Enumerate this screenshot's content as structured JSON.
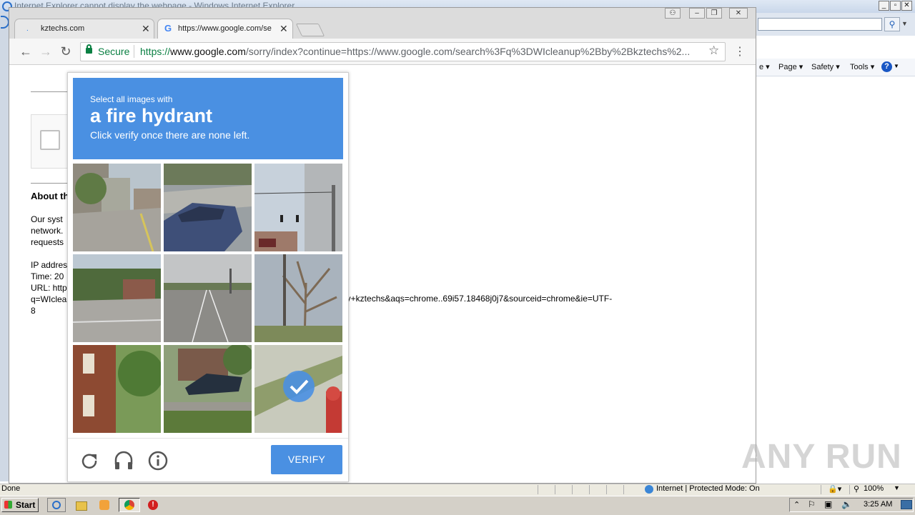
{
  "ie": {
    "title": "Internet Explorer cannot display the webpage - Windows Internet Explorer",
    "commands": [
      "Page",
      "Safety",
      "Tools"
    ],
    "status": "Done",
    "zone": "Internet | Protected Mode: On",
    "zoom": "100%"
  },
  "chrome": {
    "tabs": [
      {
        "title": "kztechs.com",
        "active": false
      },
      {
        "title": "https://www.google.com/se",
        "active": true
      }
    ],
    "secure_label": "Secure",
    "url_scheme": "https://",
    "url_host": "www.google.com",
    "url_path": "/sorry/index?continue=https://www.google.com/search%3Fq%3DWIcleanup%2Bby%2Bkztechs%2..."
  },
  "page": {
    "about_heading": "About th",
    "body_lines": [
      "Our syst",
      "network.",
      "requests"
    ],
    "ip_label": "IP addres",
    "time_label": "Time: 20",
    "url_label": "URL: http",
    "url_wrap": "q=WIclea",
    "url_tail_number": "8",
    "url_continuation": "by+kztechs&aqs=chrome..69i57.18468j0j7&sourceid=chrome&ie=UTF-"
  },
  "recaptcha": {
    "pre_text": "Select all images with",
    "target": "a fire hydrant",
    "instruction": "Click verify once there are none left.",
    "verify_label": "VERIFY",
    "tiles": [
      {
        "scene": "street-corner-buildings",
        "selected": false
      },
      {
        "scene": "parking-lot-blue-car",
        "selected": false
      },
      {
        "scene": "traffic-lights-pole",
        "selected": false
      },
      {
        "scene": "intersection-trees",
        "selected": false
      },
      {
        "scene": "highway",
        "selected": false
      },
      {
        "scene": "bare-tree-pole",
        "selected": false
      },
      {
        "scene": "brick-house",
        "selected": false
      },
      {
        "scene": "house-dark-car",
        "selected": false
      },
      {
        "scene": "fire-hydrant-closeup",
        "selected": true
      }
    ],
    "tools": [
      "reload-icon",
      "headphones-icon",
      "info-icon"
    ]
  },
  "taskbar": {
    "start_label": "Start",
    "clock": "3:25 AM"
  },
  "watermark": "ANY RUN",
  "colors": {
    "recaptcha_blue": "#4a90e2",
    "secure_green": "#0b8043"
  }
}
